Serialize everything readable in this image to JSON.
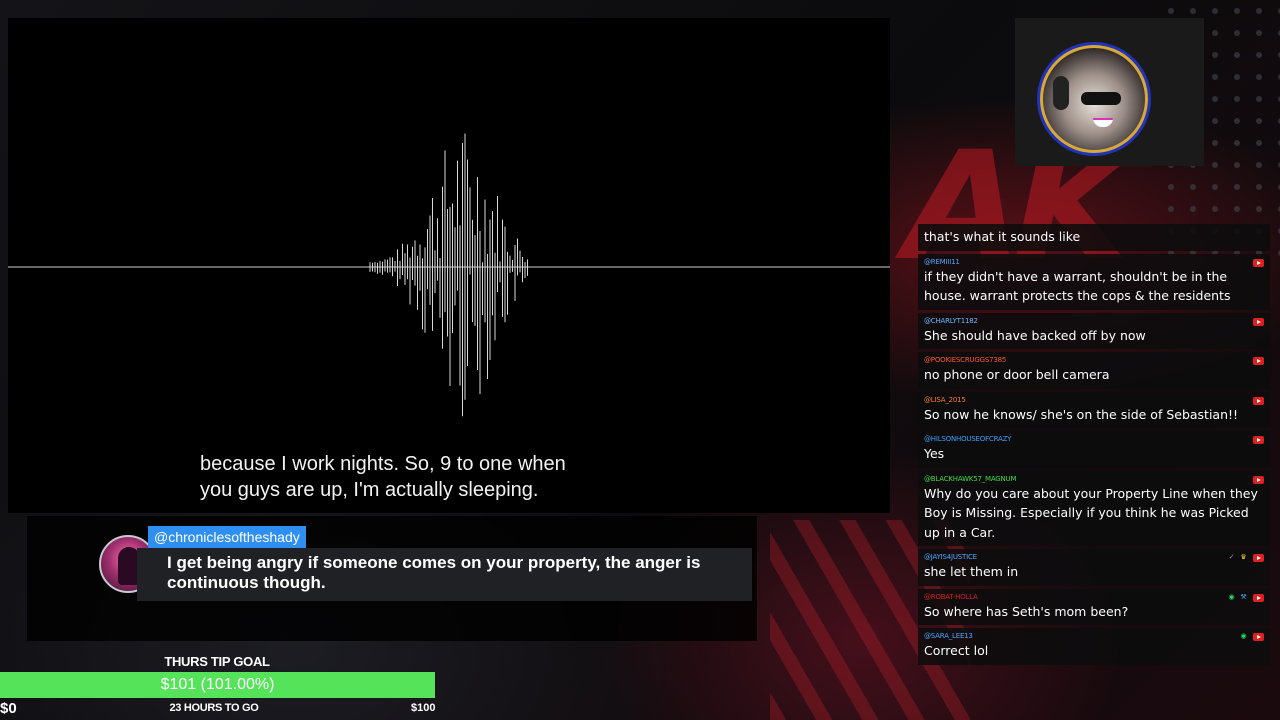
{
  "captions": {
    "line1": "because I work nights. So, 9 to one when",
    "line2": "you guys are up, I'm actually sleeping."
  },
  "featured_comment": {
    "handle": "@chroniclesoftheshady",
    "text_line1": "I get being angry if someone comes on your property, the anger is",
    "text_line2": "continuous though."
  },
  "tip_goal": {
    "title": "THURS TIP GOAL",
    "amount": "$101 (101.00%)",
    "progress_percent": 100,
    "min_label": "$0",
    "time_remaining": "23 HOURS TO GO",
    "max_label": "$100"
  },
  "chat": {
    "messages": [
      {
        "user": "",
        "user_color": "#4da6ff",
        "text": "that's what it sounds like",
        "badges": []
      },
      {
        "user": "@REMIII11",
        "user_color": "#4da6ff",
        "text": "if they didn't have a warrant, shouldn't be in the house. warrant protects the cops & the residents",
        "badges": []
      },
      {
        "user": "@CHARLYT1182",
        "user_color": "#6fb8ff",
        "text": "She should have backed off by now",
        "badges": []
      },
      {
        "user": "@POOKIESCRUGGS7385",
        "user_color": "#ff5a2c",
        "text": "no phone or door bell camera",
        "badges": []
      },
      {
        "user": "@LISA_2015",
        "user_color": "#ff7a2c",
        "text": "So now he knows/ she's on the side of Sebastian!!",
        "badges": []
      },
      {
        "user": "@HILSONHOUSEOFCRAZY",
        "user_color": "#3aa0ff",
        "text": "Yes",
        "badges": []
      },
      {
        "user": "@BLACKHAWK57_MAGNUM",
        "user_color": "#3fdc3f",
        "text": "Why do you care about your Property Line when they Boy is Missing. Especially if you think he was Picked up in a Car.",
        "badges": []
      },
      {
        "user": "@JAYIS4JUSTICE",
        "user_color": "#4da6ff",
        "text": "she let them in",
        "badges": [
          "check",
          "crown"
        ]
      },
      {
        "user": "@ROBAT-HOLLA",
        "user_color": "#d42020",
        "text": "So where has Seth's mom been?",
        "badges": [
          "green",
          "wrench"
        ]
      },
      {
        "user": "@SARA_LEE13",
        "user_color": "#4da6ff",
        "text": "Correct lol",
        "badges": [
          "green"
        ]
      }
    ]
  }
}
